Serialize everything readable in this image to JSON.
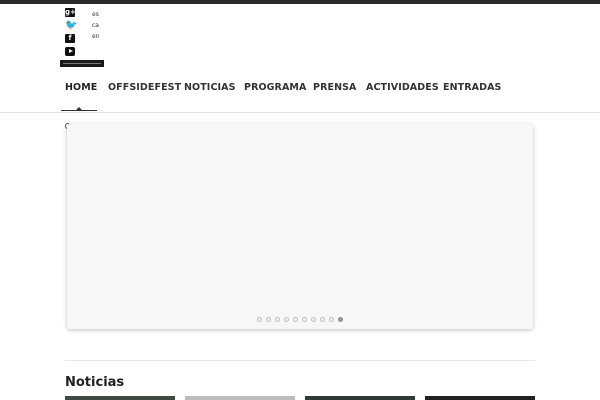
{
  "colors": {
    "top_bar": "#2b2b2b",
    "thumb_1": "#3e4a42",
    "thumb_2": "#bdbdbd",
    "thumb_3": "#2f3a33",
    "thumb_4": "#222222"
  },
  "social": {
    "icons": [
      "google-plus-icon",
      "twitter-icon",
      "facebook-icon",
      "youtube-icon"
    ],
    "gplus_glyph": "g+",
    "facebook_glyph": "f",
    "twitter_glyph": "🐦"
  },
  "languages": [
    "es",
    "ca",
    "en"
  ],
  "nav": {
    "items": [
      {
        "label": "HOME"
      },
      {
        "label": "OFFSIDEFEST"
      },
      {
        "label": "NOTICIAS"
      },
      {
        "label": "PROGRAMA"
      },
      {
        "label": "PRENSA"
      },
      {
        "label": "ACTIVIDADES"
      },
      {
        "label": "ENTRADAS"
      }
    ],
    "active_index": 0
  },
  "slider": {
    "slide_count": 10,
    "active_slide": 10
  },
  "news": {
    "title": "Noticias"
  }
}
